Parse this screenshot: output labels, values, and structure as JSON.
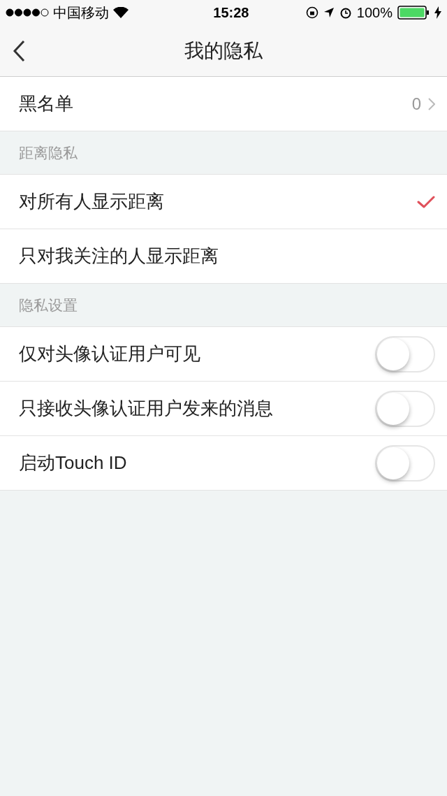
{
  "status_bar": {
    "carrier": "中国移动",
    "time": "15:28",
    "battery": "100%"
  },
  "nav": {
    "title": "我的隐私"
  },
  "blacklist": {
    "label": "黑名单",
    "count": "0"
  },
  "sections": [
    {
      "header": "距离隐私",
      "items": [
        {
          "kind": "choice",
          "label": "对所有人显示距离",
          "selected": true
        },
        {
          "kind": "choice",
          "label": "只对我关注的人显示距离",
          "selected": false
        }
      ]
    },
    {
      "header": "隐私设置",
      "items": [
        {
          "kind": "toggle",
          "label": "仅对头像认证用户可见",
          "on": false
        },
        {
          "kind": "toggle",
          "label": "只接收头像认证用户发来的消息",
          "on": false
        },
        {
          "kind": "toggle",
          "label": "启动Touch ID",
          "on": false
        }
      ]
    }
  ]
}
